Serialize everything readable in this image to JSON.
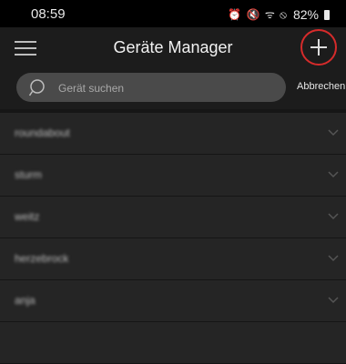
{
  "status": {
    "time": "08:59",
    "icons": "⏰ 🔇 ᯤ ⦸",
    "battery_percent": "82%"
  },
  "header": {
    "title": "Geräte Manager",
    "menu_icon": "hamburger-menu-icon",
    "add_icon": "plus-icon",
    "accent_color": "#d62b2b"
  },
  "search": {
    "placeholder": "Gerät suchen",
    "cancel_label": "Abbrechen"
  },
  "devices": [
    {
      "label": "roundabout"
    },
    {
      "label": "sturm"
    },
    {
      "label": "weitz"
    },
    {
      "label": "herzebrock"
    },
    {
      "label": "anja"
    },
    {
      "label": ""
    }
  ]
}
